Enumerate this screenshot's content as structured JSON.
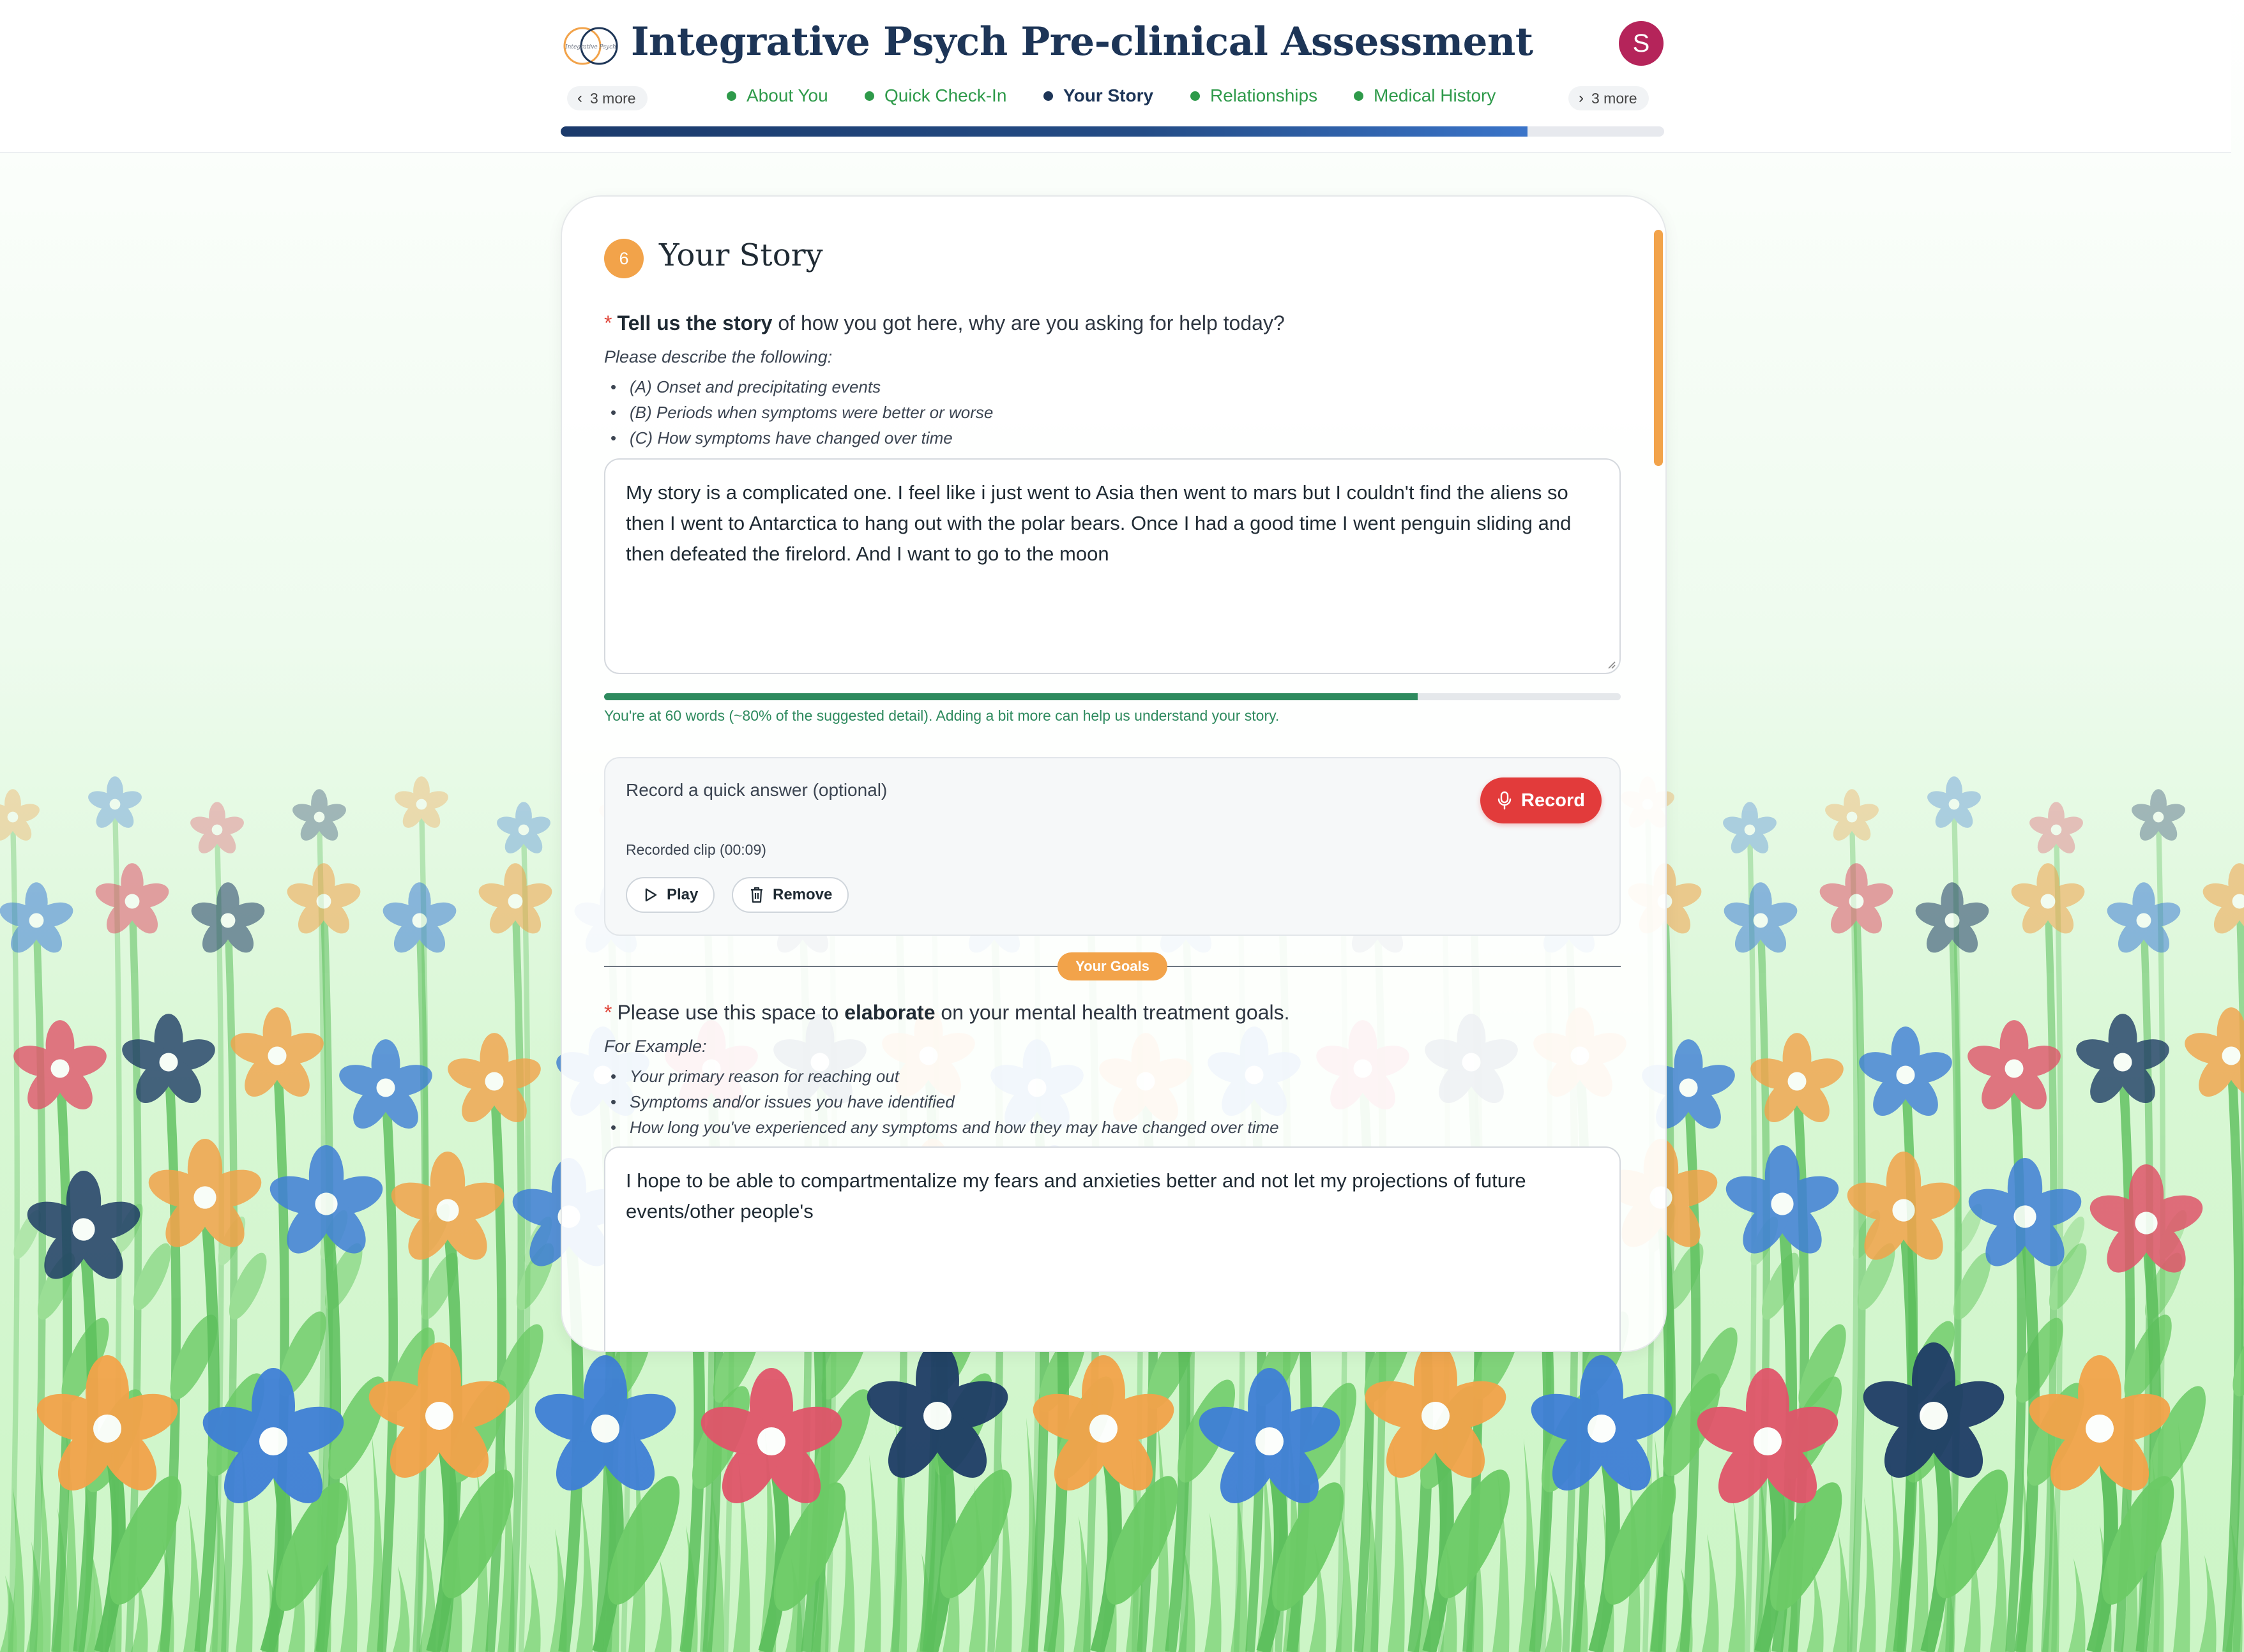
{
  "header": {
    "logo_text": "Integrative Psych",
    "title": "Integrative Psych Pre-clinical Assessment",
    "avatar_initial": "S",
    "nav": {
      "more_left": "3 more",
      "more_right": "3 more",
      "steps": [
        {
          "label": "About You",
          "state": "done"
        },
        {
          "label": "Quick Check-In",
          "state": "done"
        },
        {
          "label": "Your Story",
          "state": "active"
        },
        {
          "label": "Relationships",
          "state": "upcoming"
        },
        {
          "label": "Medical History",
          "state": "upcoming"
        }
      ]
    },
    "progress_fraction": 0.876,
    "colors": {
      "primary": "#1d3557",
      "accent": "#2e9a4a",
      "avatar": "#b5245a"
    }
  },
  "section": {
    "number": "6",
    "title": "Your Story",
    "badge_color": "#f2a34a"
  },
  "story": {
    "required_mark": "*",
    "question_bold": "Tell us the story",
    "question_rest": " of how you got here, why are you asking for help today?",
    "help_intro": "Please describe the following:",
    "help_items": [
      "(A) Onset and precipitating events",
      "(B) Periods when symptoms were better or worse",
      "(C) How symptoms have changed over time"
    ],
    "answer": "My story is a complicated one. I feel like i just went to Asia then went to mars but I couldn't find the aliens so then I went to Antarctica to hang out with the polar bears. Once I had a good time I went penguin sliding and then defeated the firelord. And I want to go to the moon",
    "word_progress_fraction": 0.8,
    "word_status": "You're at 60 words (~80% of the suggested detail). Adding a bit more can help us understand your story."
  },
  "recording": {
    "label": "Record a quick answer (optional)",
    "record_button": "Record",
    "clip_label": "Recorded clip (00:09)",
    "play_button": "Play",
    "remove_button": "Remove",
    "record_color": "#e23b3b"
  },
  "goals": {
    "divider_label": "Your Goals",
    "required_mark": "*",
    "question_pre": "Please use this space to ",
    "question_bold": "elaborate",
    "question_post": " on your mental health treatment goals.",
    "help_intro": "For Example:",
    "help_items": [
      "Your primary reason for reaching out",
      "Symptoms and/or issues you have identified",
      "How long you've experienced any symptoms and how they may have changed over time"
    ],
    "answer": "I hope to be able to compartmentalize my fears and anxieties better and not let my projections of future events/other people's"
  }
}
